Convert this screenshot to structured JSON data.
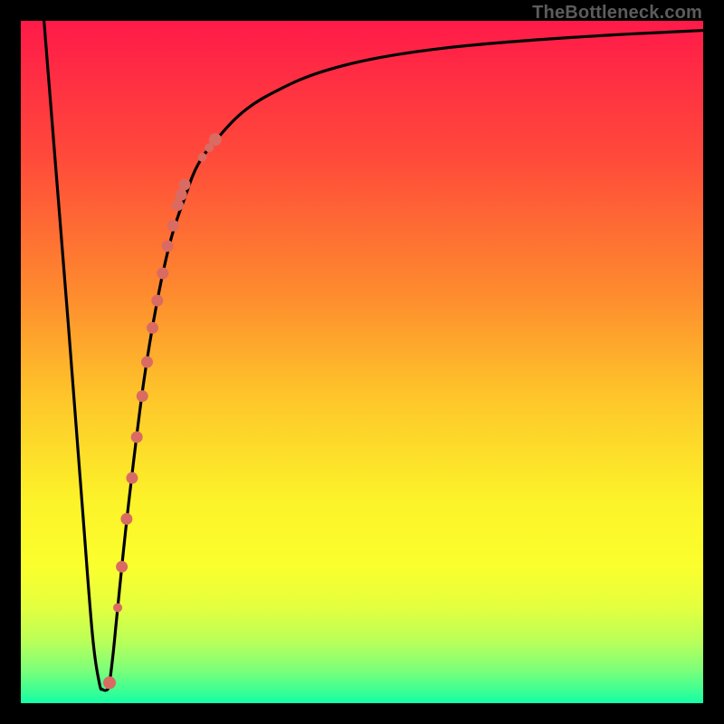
{
  "watermark": "TheBottleneck.com",
  "colors": {
    "frame": "#000000",
    "curve": "#000000",
    "dots": "#d96b63"
  },
  "chart_data": {
    "type": "line",
    "title": "",
    "xlabel": "",
    "ylabel": "",
    "xlim": [
      0,
      100
    ],
    "ylim": [
      0,
      100
    ],
    "grid": false,
    "legend": false,
    "annotations": [
      "TheBottleneck.com"
    ],
    "background_gradient_stops": [
      {
        "pos": 0.0,
        "color": "#ff1a49"
      },
      {
        "pos": 0.2,
        "color": "#ff4a3a"
      },
      {
        "pos": 0.4,
        "color": "#fe8b2e"
      },
      {
        "pos": 0.55,
        "color": "#fec52a"
      },
      {
        "pos": 0.7,
        "color": "#fcf229"
      },
      {
        "pos": 0.8,
        "color": "#fbff2d"
      },
      {
        "pos": 0.86,
        "color": "#e3ff3f"
      },
      {
        "pos": 0.91,
        "color": "#b9ff59"
      },
      {
        "pos": 0.95,
        "color": "#7fff78"
      },
      {
        "pos": 0.985,
        "color": "#35ff96"
      },
      {
        "pos": 1.0,
        "color": "#12ffa8"
      }
    ],
    "series": [
      {
        "name": "bottleneck-curve",
        "x": [
          3.4,
          5,
          7,
          9,
          10.5,
          11.5,
          12,
          12.7,
          13,
          13.5,
          14,
          14.8,
          16,
          18,
          20,
          22,
          24,
          26,
          29,
          33,
          38,
          44,
          52,
          62,
          74,
          88,
          100
        ],
        "y": [
          100,
          80,
          55,
          29,
          10,
          3,
          2,
          2,
          3,
          7,
          12,
          20,
          31,
          47,
          59,
          68,
          74,
          79,
          83,
          87,
          90,
          92.5,
          94.5,
          96,
          97.1,
          98,
          98.6
        ]
      }
    ],
    "scatter_points": {
      "name": "highlight-dots",
      "x": [
        13.0,
        14.2,
        14.8,
        15.5,
        16.3,
        17.0,
        17.8,
        18.5,
        19.3,
        20.0,
        20.8,
        21.5,
        22.3,
        23.0,
        23.5,
        24.0,
        26.6,
        27.6,
        28.5
      ],
      "y": [
        3,
        14,
        20,
        27,
        33,
        39,
        45,
        50,
        55,
        59,
        63,
        67,
        70,
        73,
        74.5,
        76,
        80,
        81.4,
        82.6
      ],
      "r": [
        7,
        5,
        6.5,
        6.5,
        6.5,
        6.5,
        6.5,
        6.5,
        6.5,
        6.5,
        6.5,
        6.5,
        6.5,
        6.5,
        6.5,
        6.5,
        5,
        5,
        7
      ]
    }
  }
}
